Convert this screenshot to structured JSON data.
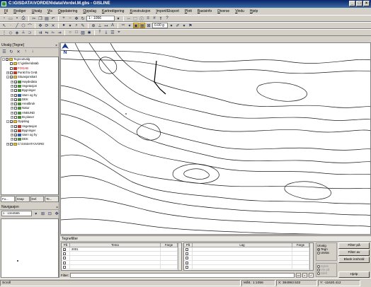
{
  "window": {
    "title": "C:\\GISDATA\\VORDEN\\data\\Vordel.M.gbs - GISLINE"
  },
  "menu": {
    "items": [
      "Fil",
      "Rediger",
      "Utvalg",
      "Vis",
      "Oppdatering",
      "Oppslag",
      "Kartredigering",
      "Konstruksjon",
      "Import/Eksport",
      "Plott",
      "Basisinfo",
      "Diverse",
      "Vindu",
      "Hjelp"
    ]
  },
  "toolbar": {
    "scale_value": "1 : 1056",
    "height_value": "0.00 g"
  },
  "layers_panel": {
    "title": "Utvalg [Tegne]",
    "tree": [
      {
        "label": "Tegneutvalg",
        "depth": 0,
        "exp": "-",
        "checked": true,
        "icon": "folder-icon",
        "red": false
      },
      {
        "label": "C:\\gisline\\datab",
        "depth": 1,
        "exp": "",
        "checked": false,
        "icon": "folder-icon",
        "red": false
      },
      {
        "label": "FOGAB",
        "depth": 1,
        "exp": "",
        "checked": false,
        "icon": "red-icon",
        "red": true
      },
      {
        "label": "Punkt fra GAB",
        "depth": 1,
        "exp": "+",
        "checked": false,
        "icon": "red-icon",
        "red": false
      },
      {
        "label": "Situasjonskart",
        "depth": 1,
        "exp": "-",
        "checked": true,
        "icon": "folder-icon",
        "red": false
      },
      {
        "label": "Høydedata",
        "depth": 2,
        "exp": "+",
        "checked": true,
        "icon": "layer-icon",
        "red": false
      },
      {
        "label": "Vegetasjon",
        "depth": 2,
        "exp": "+",
        "checked": true,
        "icon": "layer-icon",
        "red": false
      },
      {
        "label": "Bygninger",
        "depth": 2,
        "exp": "+",
        "checked": true,
        "icon": "layer-icon",
        "red": false
      },
      {
        "label": "Vann og hy",
        "depth": 2,
        "exp": "+",
        "checked": true,
        "icon": "blue-icon",
        "red": false
      },
      {
        "label": "DEK",
        "depth": 2,
        "exp": "+",
        "checked": true,
        "icon": "layer-icon",
        "red": false
      },
      {
        "label": "Arealbruk",
        "depth": 2,
        "exp": "+",
        "checked": false,
        "icon": "layer-icon",
        "red": false
      },
      {
        "label": "Natur",
        "depth": 2,
        "exp": "+",
        "checked": false,
        "icon": "layer-icon",
        "red": false
      },
      {
        "label": "ANBUND",
        "depth": 2,
        "exp": "+",
        "checked": false,
        "icon": "layer-icon",
        "red": false
      },
      {
        "label": "Br.planer",
        "depth": 2,
        "exp": "+",
        "checked": false,
        "icon": "layer-icon",
        "red": false
      },
      {
        "label": "Oppslag",
        "depth": 1,
        "exp": "-",
        "checked": true,
        "icon": "folder-icon",
        "red": false
      },
      {
        "label": "Vegetasjon",
        "depth": 2,
        "exp": "+",
        "checked": true,
        "icon": "red-icon",
        "red": false
      },
      {
        "label": "Bygninger",
        "depth": 2,
        "exp": "+",
        "checked": true,
        "icon": "red-icon",
        "red": false
      },
      {
        "label": "Vann og hy",
        "depth": 2,
        "exp": "+",
        "checked": true,
        "icon": "blue-icon",
        "red": false
      },
      {
        "label": "DEK",
        "depth": 2,
        "exp": "+",
        "checked": true,
        "icon": "layer-icon",
        "red": false
      },
      {
        "label": "C:\\GISDATA\\VORD",
        "depth": 1,
        "exp": "+",
        "checked": false,
        "icon": "folder-icon",
        "red": false
      }
    ],
    "tabs": [
      "Fu...",
      "Snap",
      "Def.",
      "Te..."
    ]
  },
  "navigation_panel": {
    "title": "Navigasjon",
    "scale_value": "1 : 1344565"
  },
  "filter_panel": {
    "title": "Tegnefilter",
    "left_headers": [
      "På",
      "Tema",
      "Farge"
    ],
    "left_rows": [
      {
        "on": true,
        "tema": "2001"
      },
      {
        "on": false,
        "tema": ""
      },
      {
        "on": false,
        "tema": ""
      },
      {
        "on": false,
        "tema": ""
      },
      {
        "on": false,
        "tema": ""
      }
    ],
    "right_headers": [
      "På",
      "Lag",
      "Farge"
    ],
    "right_row_count": 5,
    "filter_label": "Filter:",
    "utvalg_title": "Utvalg",
    "utvalg_options": [
      "Tegn",
      "Utelat"
    ],
    "disabled_options": [
      "Sykle",
      "Vis på",
      "Slett"
    ],
    "buttons": {
      "filter_pa": "Filter på",
      "filter_av": "Filter av",
      "blank_innhold": "Blank innhold",
      "hjelp": "Hjelp"
    }
  },
  "statusbar": {
    "mode": "Scroll",
    "scale": "Målt.: 1:1056",
    "x": "X: 384993.533",
    "y": "Y: -11620.412"
  }
}
